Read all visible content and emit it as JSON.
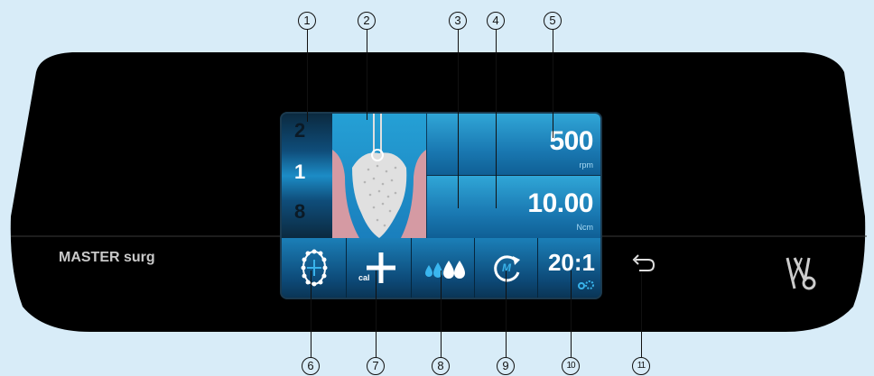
{
  "device": {
    "brand_label": "MASTER surg",
    "logo_name": "kavo-logo"
  },
  "screen": {
    "program_levels": [
      "2",
      "1",
      "8"
    ],
    "speed": {
      "value": "500",
      "unit": "rpm"
    },
    "torque": {
      "value": "10.00",
      "unit": "Ncm"
    },
    "buttons": {
      "implant_position": {
        "icon": "tooth-arch-icon"
      },
      "calibration": {
        "label": "cal",
        "icon": "plus-icon"
      },
      "coolant": {
        "icon": "water-drops-icon"
      },
      "rotation": {
        "label": "M",
        "icon": "rotation-icon"
      },
      "ratio": {
        "value": "20:1",
        "icon": "gears-icon"
      }
    }
  },
  "callouts": [
    "1",
    "2",
    "3",
    "4",
    "5",
    "6",
    "7",
    "8",
    "9",
    "10",
    "11"
  ],
  "colors": {
    "background": "#d8ecf8",
    "device_body": "#000000",
    "screen_accent": "#1a79b2",
    "tooth_bg": "#d9a0a8"
  }
}
